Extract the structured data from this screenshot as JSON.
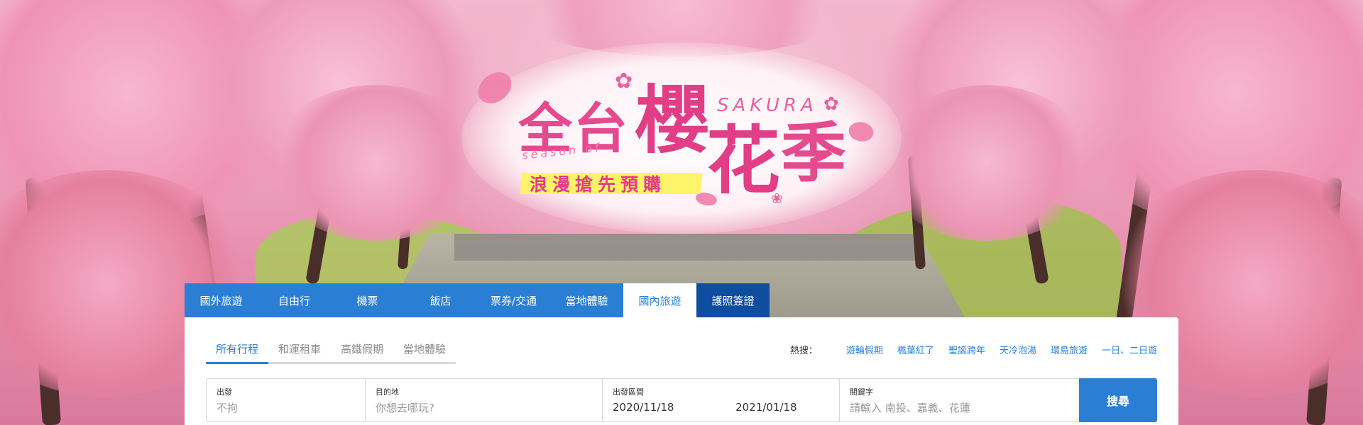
{
  "banner": {
    "title_part1": "全台",
    "title_char1": "櫻",
    "title_char2": "花",
    "title_char3": "季",
    "english_word": "SAKURA",
    "season_of": "season of",
    "subtitle": "浪漫搶先預購",
    "colors": {
      "title": "#e23d87",
      "highlight": "#fff36a"
    }
  },
  "main_tabs": [
    {
      "label": "國外旅遊"
    },
    {
      "label": "自由行"
    },
    {
      "label": "機票"
    },
    {
      "label": "飯店"
    },
    {
      "label": "票券/交通"
    },
    {
      "label": "當地體驗"
    },
    {
      "label": "國內旅遊",
      "active": true
    },
    {
      "label": "護照簽證"
    }
  ],
  "sub_tabs": [
    {
      "label": "所有行程",
      "active": true
    },
    {
      "label": "和運租車"
    },
    {
      "label": "高鐵假期"
    },
    {
      "label": "當地體驗"
    }
  ],
  "hot_search": {
    "label": "熱搜：",
    "items": [
      "遊輪假期",
      "楓葉紅了",
      "聖誕跨年",
      "天冷泡湯",
      "環島旅遊",
      "一日、二日遊"
    ]
  },
  "search": {
    "departure": {
      "label": "出發",
      "placeholder": "不拘"
    },
    "destination": {
      "label": "目的地",
      "placeholder": "你想去哪玩?"
    },
    "date_range": {
      "label": "出發區間",
      "start": "2020/11/18",
      "end": "2021/01/18"
    },
    "keyword": {
      "label": "關鍵字",
      "placeholder": "請輸入 南投、嘉義、花蓮"
    },
    "button_label": "搜尋"
  },
  "colors": {
    "primary": "#2a7fd4",
    "dark": "#0f4d9e"
  }
}
